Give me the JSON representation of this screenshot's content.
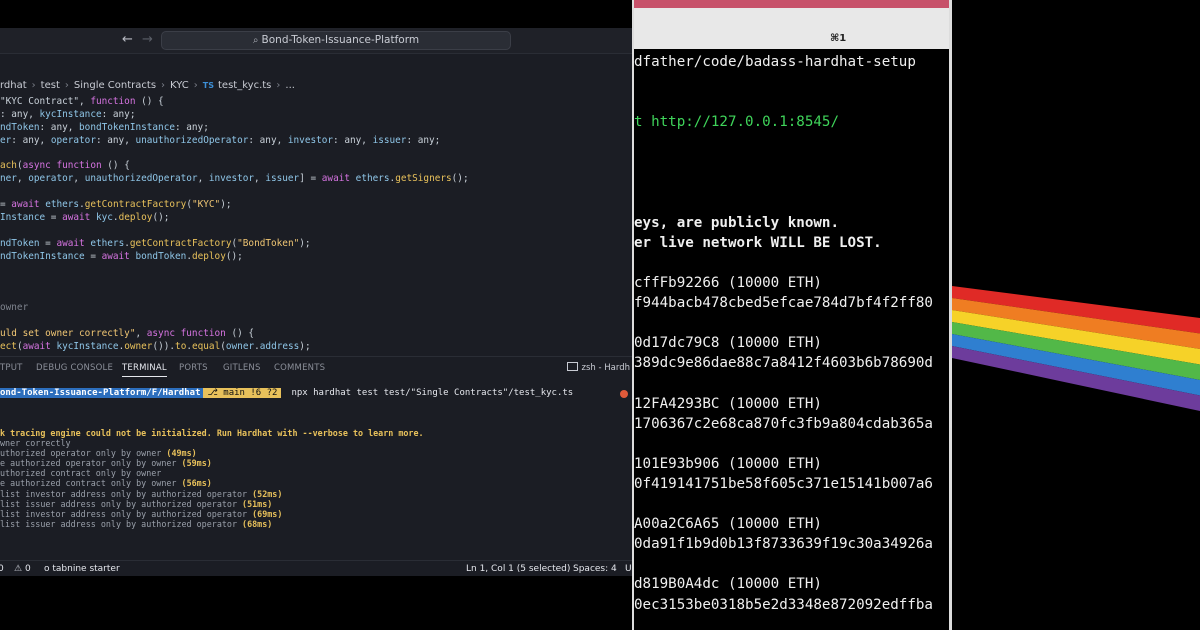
{
  "vscode": {
    "search_label": "Bond-Token-Issuance-Platform",
    "breadcrumb": [
      "rdhat",
      "test",
      "Single Contracts",
      "KYC",
      "test_kyc.ts",
      "..."
    ],
    "breadcrumb_ts_badge": "TS",
    "code_lines": [
      [
        {
          "c": "p",
          "t": "\"KYC Contract\", "
        },
        {
          "c": "k",
          "t": "function"
        },
        {
          "c": "p",
          "t": " () {"
        }
      ],
      [
        {
          "c": "p",
          "t": ": any, "
        },
        {
          "c": "v",
          "t": "kycInstance"
        },
        {
          "c": "p",
          "t": ": any;"
        }
      ],
      [
        {
          "c": "v",
          "t": "ndToken"
        },
        {
          "c": "p",
          "t": ": any, "
        },
        {
          "c": "v",
          "t": "bondTokenInstance"
        },
        {
          "c": "p",
          "t": ": any;"
        }
      ],
      [
        {
          "c": "v",
          "t": "er"
        },
        {
          "c": "p",
          "t": ": any, "
        },
        {
          "c": "v",
          "t": "operator"
        },
        {
          "c": "p",
          "t": ": any, "
        },
        {
          "c": "v",
          "t": "unauthorizedOperator"
        },
        {
          "c": "p",
          "t": ": any, "
        },
        {
          "c": "v",
          "t": "investor"
        },
        {
          "c": "p",
          "t": ": any, "
        },
        {
          "c": "v",
          "t": "issuer"
        },
        {
          "c": "p",
          "t": ": any;"
        }
      ],
      [],
      [
        {
          "c": "f",
          "t": "ach"
        },
        {
          "c": "p",
          "t": "("
        },
        {
          "c": "k",
          "t": "async function"
        },
        {
          "c": "p",
          "t": " () {"
        }
      ],
      [
        {
          "c": "v",
          "t": "ner"
        },
        {
          "c": "p",
          "t": ", "
        },
        {
          "c": "v",
          "t": "operator"
        },
        {
          "c": "p",
          "t": ", "
        },
        {
          "c": "v",
          "t": "unauthorizedOperator"
        },
        {
          "c": "p",
          "t": ", "
        },
        {
          "c": "v",
          "t": "investor"
        },
        {
          "c": "p",
          "t": ", "
        },
        {
          "c": "v",
          "t": "issuer"
        },
        {
          "c": "p",
          "t": "] = "
        },
        {
          "c": "k",
          "t": "await"
        },
        {
          "c": "p",
          "t": " "
        },
        {
          "c": "v",
          "t": "ethers"
        },
        {
          "c": "p",
          "t": "."
        },
        {
          "c": "f",
          "t": "getSigners"
        },
        {
          "c": "p",
          "t": "();"
        }
      ],
      [],
      [
        {
          "c": "p",
          "t": "= "
        },
        {
          "c": "k",
          "t": "await"
        },
        {
          "c": "p",
          "t": " "
        },
        {
          "c": "v",
          "t": "ethers"
        },
        {
          "c": "p",
          "t": "."
        },
        {
          "c": "f",
          "t": "getContractFactory"
        },
        {
          "c": "p",
          "t": "("
        },
        {
          "c": "s",
          "t": "\"KYC\""
        },
        {
          "c": "p",
          "t": ");"
        }
      ],
      [
        {
          "c": "v",
          "t": "Instance"
        },
        {
          "c": "p",
          "t": " = "
        },
        {
          "c": "k",
          "t": "await"
        },
        {
          "c": "p",
          "t": " "
        },
        {
          "c": "v",
          "t": "kyc"
        },
        {
          "c": "p",
          "t": "."
        },
        {
          "c": "f",
          "t": "deploy"
        },
        {
          "c": "p",
          "t": "();"
        }
      ],
      [],
      [
        {
          "c": "v",
          "t": "ndToken"
        },
        {
          "c": "p",
          "t": " = "
        },
        {
          "c": "k",
          "t": "await"
        },
        {
          "c": "p",
          "t": " "
        },
        {
          "c": "v",
          "t": "ethers"
        },
        {
          "c": "p",
          "t": "."
        },
        {
          "c": "f",
          "t": "getContractFactory"
        },
        {
          "c": "p",
          "t": "("
        },
        {
          "c": "s",
          "t": "\"BondToken\""
        },
        {
          "c": "p",
          "t": ");"
        }
      ],
      [
        {
          "c": "v",
          "t": "ndTokenInstance"
        },
        {
          "c": "p",
          "t": " = "
        },
        {
          "c": "k",
          "t": "await"
        },
        {
          "c": "p",
          "t": " "
        },
        {
          "c": "v",
          "t": "bondToken"
        },
        {
          "c": "p",
          "t": "."
        },
        {
          "c": "f",
          "t": "deploy"
        },
        {
          "c": "p",
          "t": "();"
        }
      ],
      [],
      [],
      [],
      [
        {
          "c": "c",
          "t": "owner"
        }
      ],
      [],
      [
        {
          "c": "s",
          "t": "uld set owner correctly\""
        },
        {
          "c": "p",
          "t": ", "
        },
        {
          "c": "k",
          "t": "async function"
        },
        {
          "c": "p",
          "t": " () {"
        }
      ],
      [
        {
          "c": "f",
          "t": "ect"
        },
        {
          "c": "p",
          "t": "("
        },
        {
          "c": "k",
          "t": "await"
        },
        {
          "c": "p",
          "t": " "
        },
        {
          "c": "v",
          "t": "kycInstance"
        },
        {
          "c": "p",
          "t": "."
        },
        {
          "c": "f",
          "t": "owner"
        },
        {
          "c": "p",
          "t": "())."
        },
        {
          "c": "f",
          "t": "to"
        },
        {
          "c": "p",
          "t": "."
        },
        {
          "c": "f",
          "t": "equal"
        },
        {
          "c": "p",
          "t": "("
        },
        {
          "c": "v",
          "t": "owner"
        },
        {
          "c": "p",
          "t": "."
        },
        {
          "c": "v",
          "t": "address"
        },
        {
          "c": "p",
          "t": ");"
        }
      ]
    ],
    "panel_tabs": [
      "TPUT",
      "DEBUG CONSOLE",
      "TERMINAL",
      "PORTS",
      "GITLENS",
      "COMMENTS"
    ],
    "active_panel_tab": "TERMINAL",
    "terminal_label": "zsh - Hardh",
    "prompt": {
      "path": "ond-Token-Issuance-Platform/F/Hardhat",
      "git": "main !6 ?2",
      "command": "npx hardhat test test/\"Single Contracts\"/test_kyc.ts"
    },
    "terminal_warning": "k tracing engine could not be initialized. Run Hardhat with --verbose to learn more.",
    "test_results": [
      {
        "text": "wner correctly",
        "dur": ""
      },
      {
        "text": "uthorized operator only by owner ",
        "dur": "(49ms)"
      },
      {
        "text": "e authorized operator only by owner ",
        "dur": "(59ms)"
      },
      {
        "text": "uthorized contract only by owner",
        "dur": ""
      },
      {
        "text": "e authorized contract only by owner ",
        "dur": "(56ms)"
      },
      {
        "text": "list investor address only by authorized operator ",
        "dur": "(52ms)"
      },
      {
        "text": "list issuer address only by authorized operator ",
        "dur": "(51ms)"
      },
      {
        "text": "list investor address only by authorized operator ",
        "dur": "(69ms)"
      },
      {
        "text": "list issuer address only by authorized operator ",
        "dur": "(68ms)"
      }
    ],
    "status": {
      "errors": "0",
      "warnings": "0",
      "tabnine": "tabnine starter",
      "position": "Ln 1, Col 1 (5 selected)",
      "spaces": "Spaces: 4",
      "encoding": "U"
    }
  },
  "terminal": {
    "shortcut": "⌘1",
    "lines": [
      {
        "t": "dfather/code/badass-hardhat-setup",
        "style": ""
      },
      {
        "t": "",
        "style": ""
      },
      {
        "t": "",
        "style": ""
      },
      {
        "t": "t http://127.0.0.1:8545/",
        "style": "green"
      },
      {
        "t": "",
        "style": ""
      },
      {
        "t": "",
        "style": ""
      },
      {
        "t": "",
        "style": ""
      },
      {
        "t": "",
        "style": ""
      },
      {
        "t": "eys, are publicly known.",
        "style": "bold"
      },
      {
        "t": "er live network WILL BE LOST.",
        "style": "bold"
      },
      {
        "t": "",
        "style": ""
      },
      {
        "t": "cffFb92266 (10000 ETH)",
        "style": ""
      },
      {
        "t": "f944bacb478cbed5efcae784d7bf4f2ff80",
        "style": ""
      },
      {
        "t": "",
        "style": ""
      },
      {
        "t": "0d17dc79C8 (10000 ETH)",
        "style": ""
      },
      {
        "t": "389dc9e86dae88c7a8412f4603b6b78690d",
        "style": ""
      },
      {
        "t": "",
        "style": ""
      },
      {
        "t": "12FA4293BC (10000 ETH)",
        "style": ""
      },
      {
        "t": "1706367c2e68ca870fc3fb9a804cdab365a",
        "style": ""
      },
      {
        "t": "",
        "style": ""
      },
      {
        "t": "101E93b906 (10000 ETH)",
        "style": ""
      },
      {
        "t": "0f419141751be58f605c371e15141b007a6",
        "style": ""
      },
      {
        "t": "",
        "style": ""
      },
      {
        "t": "A00a2C6A65 (10000 ETH)",
        "style": ""
      },
      {
        "t": "0da91f1b9d0b13f8733639f19c30a34926a",
        "style": ""
      },
      {
        "t": "",
        "style": ""
      },
      {
        "t": "d819B0A4dc (10000 ETH)",
        "style": ""
      },
      {
        "t": "0ec3153be0318b5e2d3348e872092edffba",
        "style": ""
      }
    ]
  },
  "prism": {
    "colors": [
      "#e02a26",
      "#ef7d22",
      "#f6d228",
      "#52b848",
      "#2f7fd0",
      "#6d3c9c"
    ]
  }
}
